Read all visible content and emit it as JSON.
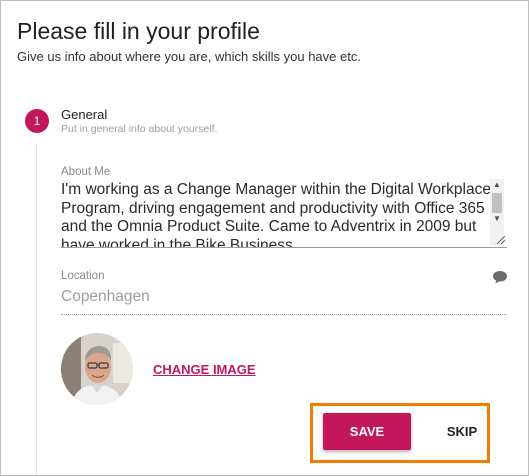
{
  "header": {
    "title": "Please fill in your profile",
    "subtitle": "Give us info about where you are, which skills you have etc."
  },
  "step": {
    "number": "1",
    "title": "General",
    "description": "Put in general info about yourself."
  },
  "about": {
    "label": "About Me",
    "value": "I'm working as a Change Manager within the Digital Workplace Program, driving engagement and productivity with Office 365 and the Omnia Product Suite. Came to Adventrix in 2009 but have worked in the Bike Business"
  },
  "location": {
    "label": "Location",
    "value": "Copenhagen"
  },
  "image": {
    "change_label": "CHANGE IMAGE"
  },
  "actions": {
    "save_label": "SAVE",
    "skip_label": "SKIP"
  },
  "colors": {
    "accent": "#c2185b",
    "highlight": "#f57c00"
  }
}
